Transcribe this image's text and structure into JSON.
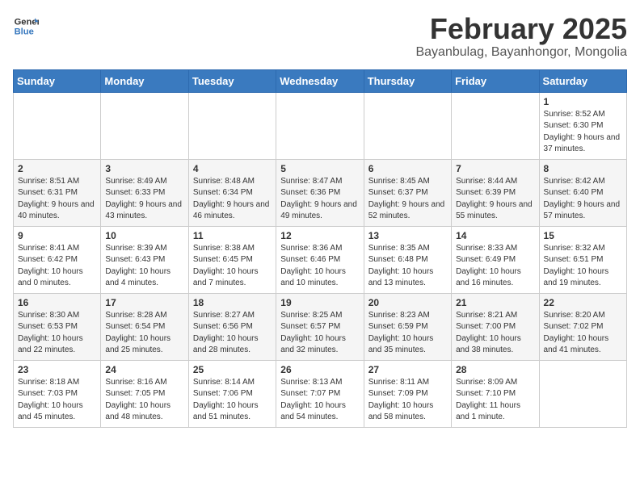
{
  "header": {
    "logo_general": "General",
    "logo_blue": "Blue",
    "month_year": "February 2025",
    "location": "Bayanbulag, Bayanhongor, Mongolia"
  },
  "weekdays": [
    "Sunday",
    "Monday",
    "Tuesday",
    "Wednesday",
    "Thursday",
    "Friday",
    "Saturday"
  ],
  "weeks": [
    [
      {
        "day": "",
        "info": ""
      },
      {
        "day": "",
        "info": ""
      },
      {
        "day": "",
        "info": ""
      },
      {
        "day": "",
        "info": ""
      },
      {
        "day": "",
        "info": ""
      },
      {
        "day": "",
        "info": ""
      },
      {
        "day": "1",
        "info": "Sunrise: 8:52 AM\nSunset: 6:30 PM\nDaylight: 9 hours and 37 minutes."
      }
    ],
    [
      {
        "day": "2",
        "info": "Sunrise: 8:51 AM\nSunset: 6:31 PM\nDaylight: 9 hours and 40 minutes."
      },
      {
        "day": "3",
        "info": "Sunrise: 8:49 AM\nSunset: 6:33 PM\nDaylight: 9 hours and 43 minutes."
      },
      {
        "day": "4",
        "info": "Sunrise: 8:48 AM\nSunset: 6:34 PM\nDaylight: 9 hours and 46 minutes."
      },
      {
        "day": "5",
        "info": "Sunrise: 8:47 AM\nSunset: 6:36 PM\nDaylight: 9 hours and 49 minutes."
      },
      {
        "day": "6",
        "info": "Sunrise: 8:45 AM\nSunset: 6:37 PM\nDaylight: 9 hours and 52 minutes."
      },
      {
        "day": "7",
        "info": "Sunrise: 8:44 AM\nSunset: 6:39 PM\nDaylight: 9 hours and 55 minutes."
      },
      {
        "day": "8",
        "info": "Sunrise: 8:42 AM\nSunset: 6:40 PM\nDaylight: 9 hours and 57 minutes."
      }
    ],
    [
      {
        "day": "9",
        "info": "Sunrise: 8:41 AM\nSunset: 6:42 PM\nDaylight: 10 hours and 0 minutes."
      },
      {
        "day": "10",
        "info": "Sunrise: 8:39 AM\nSunset: 6:43 PM\nDaylight: 10 hours and 4 minutes."
      },
      {
        "day": "11",
        "info": "Sunrise: 8:38 AM\nSunset: 6:45 PM\nDaylight: 10 hours and 7 minutes."
      },
      {
        "day": "12",
        "info": "Sunrise: 8:36 AM\nSunset: 6:46 PM\nDaylight: 10 hours and 10 minutes."
      },
      {
        "day": "13",
        "info": "Sunrise: 8:35 AM\nSunset: 6:48 PM\nDaylight: 10 hours and 13 minutes."
      },
      {
        "day": "14",
        "info": "Sunrise: 8:33 AM\nSunset: 6:49 PM\nDaylight: 10 hours and 16 minutes."
      },
      {
        "day": "15",
        "info": "Sunrise: 8:32 AM\nSunset: 6:51 PM\nDaylight: 10 hours and 19 minutes."
      }
    ],
    [
      {
        "day": "16",
        "info": "Sunrise: 8:30 AM\nSunset: 6:53 PM\nDaylight: 10 hours and 22 minutes."
      },
      {
        "day": "17",
        "info": "Sunrise: 8:28 AM\nSunset: 6:54 PM\nDaylight: 10 hours and 25 minutes."
      },
      {
        "day": "18",
        "info": "Sunrise: 8:27 AM\nSunset: 6:56 PM\nDaylight: 10 hours and 28 minutes."
      },
      {
        "day": "19",
        "info": "Sunrise: 8:25 AM\nSunset: 6:57 PM\nDaylight: 10 hours and 32 minutes."
      },
      {
        "day": "20",
        "info": "Sunrise: 8:23 AM\nSunset: 6:59 PM\nDaylight: 10 hours and 35 minutes."
      },
      {
        "day": "21",
        "info": "Sunrise: 8:21 AM\nSunset: 7:00 PM\nDaylight: 10 hours and 38 minutes."
      },
      {
        "day": "22",
        "info": "Sunrise: 8:20 AM\nSunset: 7:02 PM\nDaylight: 10 hours and 41 minutes."
      }
    ],
    [
      {
        "day": "23",
        "info": "Sunrise: 8:18 AM\nSunset: 7:03 PM\nDaylight: 10 hours and 45 minutes."
      },
      {
        "day": "24",
        "info": "Sunrise: 8:16 AM\nSunset: 7:05 PM\nDaylight: 10 hours and 48 minutes."
      },
      {
        "day": "25",
        "info": "Sunrise: 8:14 AM\nSunset: 7:06 PM\nDaylight: 10 hours and 51 minutes."
      },
      {
        "day": "26",
        "info": "Sunrise: 8:13 AM\nSunset: 7:07 PM\nDaylight: 10 hours and 54 minutes."
      },
      {
        "day": "27",
        "info": "Sunrise: 8:11 AM\nSunset: 7:09 PM\nDaylight: 10 hours and 58 minutes."
      },
      {
        "day": "28",
        "info": "Sunrise: 8:09 AM\nSunset: 7:10 PM\nDaylight: 11 hours and 1 minute."
      },
      {
        "day": "",
        "info": ""
      }
    ]
  ]
}
